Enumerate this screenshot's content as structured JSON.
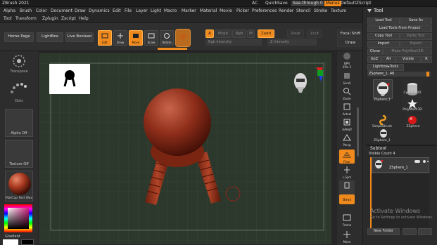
{
  "app": {
    "title": "ZBrush 2021"
  },
  "title_bar": {
    "ac": "AC",
    "quicksave": "QuickSave",
    "seethrough": "See-through  0",
    "menus": "Menus",
    "script": "DefaultZScript"
  },
  "menu": {
    "row1": [
      "Alpha",
      "Brush",
      "Color",
      "Document",
      "Draw",
      "Dynamics",
      "Edit",
      "File",
      "Layer",
      "Light",
      "Macro",
      "Marker",
      "Material",
      "Movie",
      "Picker",
      "Preferences",
      "Render",
      "Stencil",
      "Stroke",
      "Texture"
    ],
    "row2": [
      "Tool",
      "Transform",
      "Zplugin",
      "Zscript",
      "Help"
    ]
  },
  "toolbar": {
    "home": "Home Page",
    "lightbox": "LightBox",
    "live_boolean": "Live Boolean",
    "edit": "Edit",
    "draw": "Draw",
    "move": "Move",
    "scale": "Scale",
    "rotate": "Rotate",
    "a_label": "A",
    "mrgb": "Mrgb",
    "rgb": "Rgb",
    "m": "M",
    "zadd": "Zadd",
    "zsub": "Zsub",
    "zcut": "Zcut",
    "rgb_intensity": "Rgb Intensity",
    "z_intensity": "Z Intensity",
    "focal_shift": "Focal Shift",
    "draw_size": "Draw"
  },
  "left": {
    "transpose": "Transpose",
    "dots": "Dots",
    "alpha": "Alpha Off",
    "texture": "Texture Off",
    "matcap": "MatCap Red Wax",
    "gradient": "Gradient"
  },
  "right_shelf": [
    "BPR",
    "SPix 3",
    "Scroll",
    "Zoom",
    "Actual",
    "AAHalf",
    "Persp",
    "Floor",
    "L.Sym",
    "Gxyz",
    "Frame",
    "Move"
  ],
  "tool": {
    "header": "Tool",
    "load_tool": "Load Tool",
    "save_as": "Save As",
    "load_from_project": "Load Tools From Project",
    "copy_tool": "Copy Tool",
    "paste_tool": "Paste Tool",
    "import": "Import",
    "export": "Export",
    "clone": "Clone",
    "make_polymesh": "Make PolyMesh3D",
    "goz": "GoZ",
    "all": "All",
    "visible": "Visible",
    "r": "R",
    "lightbox_tools": "Lightbox▸Tools",
    "current": "ZSphere_1. 46",
    "items": [
      "ZSphere_1",
      "Cylinder3D",
      "PolyMesh3D",
      "SimpleBrush",
      "ZSphere",
      "ZSphere_1"
    ],
    "subtool": "Subtool",
    "visible_count": "Visible Count 4",
    "subtool_item": "ZSphere_1",
    "new_folder": "New Folder",
    "activate": "Activate Windows",
    "activate_sub": "Go to Settings to activate Windows."
  }
}
